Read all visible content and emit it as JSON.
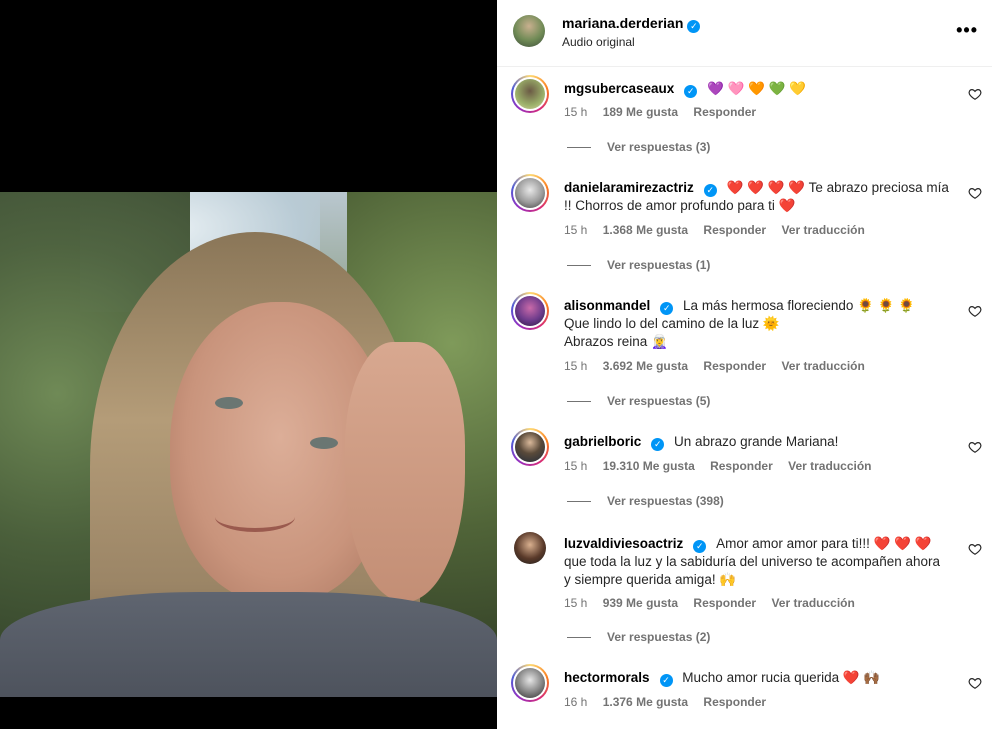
{
  "post": {
    "username": "mariana.derderian",
    "subtitle": "Audio original"
  },
  "comments": [
    {
      "user": "mgsubercaseaux",
      "text": "💜 🩷 🧡 💚 💛",
      "time": "15 h",
      "likes": "189 Me gusta",
      "reply": "Responder",
      "translate": "",
      "replies": "Ver respuestas (3)"
    },
    {
      "user": "danielaramirezactriz",
      "text": "❤️ ❤️ ❤️ ❤️ Te abrazo preciosa mía !! Chorros de amor profundo para ti ❤️",
      "time": "15 h",
      "likes": "1.368 Me gusta",
      "reply": "Responder",
      "translate": "Ver traducción",
      "replies": "Ver respuestas (1)"
    },
    {
      "user": "alisonmandel",
      "text_lines": [
        "La más hermosa floreciendo 🌻 🌻 🌻",
        "Que lindo lo del camino de la luz 🌞",
        "Abrazos reina 🧝‍♀️"
      ],
      "time": "15 h",
      "likes": "3.692 Me gusta",
      "reply": "Responder",
      "translate": "Ver traducción",
      "replies": "Ver respuestas (5)"
    },
    {
      "user": "gabrielboric",
      "text": "Un abrazo grande Mariana!",
      "time": "15 h",
      "likes": "19.310 Me gusta",
      "reply": "Responder",
      "translate": "Ver traducción",
      "replies": "Ver respuestas (398)"
    },
    {
      "user": "luzvaldiviesoactriz",
      "text": "Amor amor amor para ti!!! ❤️ ❤️ ❤️ que toda la luz y la sabiduría del universo te acompañen ahora y siempre querida amiga! 🙌",
      "time": "15 h",
      "likes": "939 Me gusta",
      "reply": "Responder",
      "translate": "Ver traducción",
      "replies": "Ver respuestas (2)"
    },
    {
      "user": "hectormorals",
      "text": "Mucho amor rucia querida ❤️ 🙌🏾",
      "time": "16 h",
      "likes": "1.376 Me gusta",
      "reply": "Responder",
      "translate": ""
    }
  ],
  "icons": {
    "more": "more-options-icon",
    "verified": "verified-badge-icon",
    "like": "heart-outline-icon"
  },
  "colors": {
    "verified": "#0095f6",
    "meta": "#737373",
    "divider": "#efefef"
  }
}
